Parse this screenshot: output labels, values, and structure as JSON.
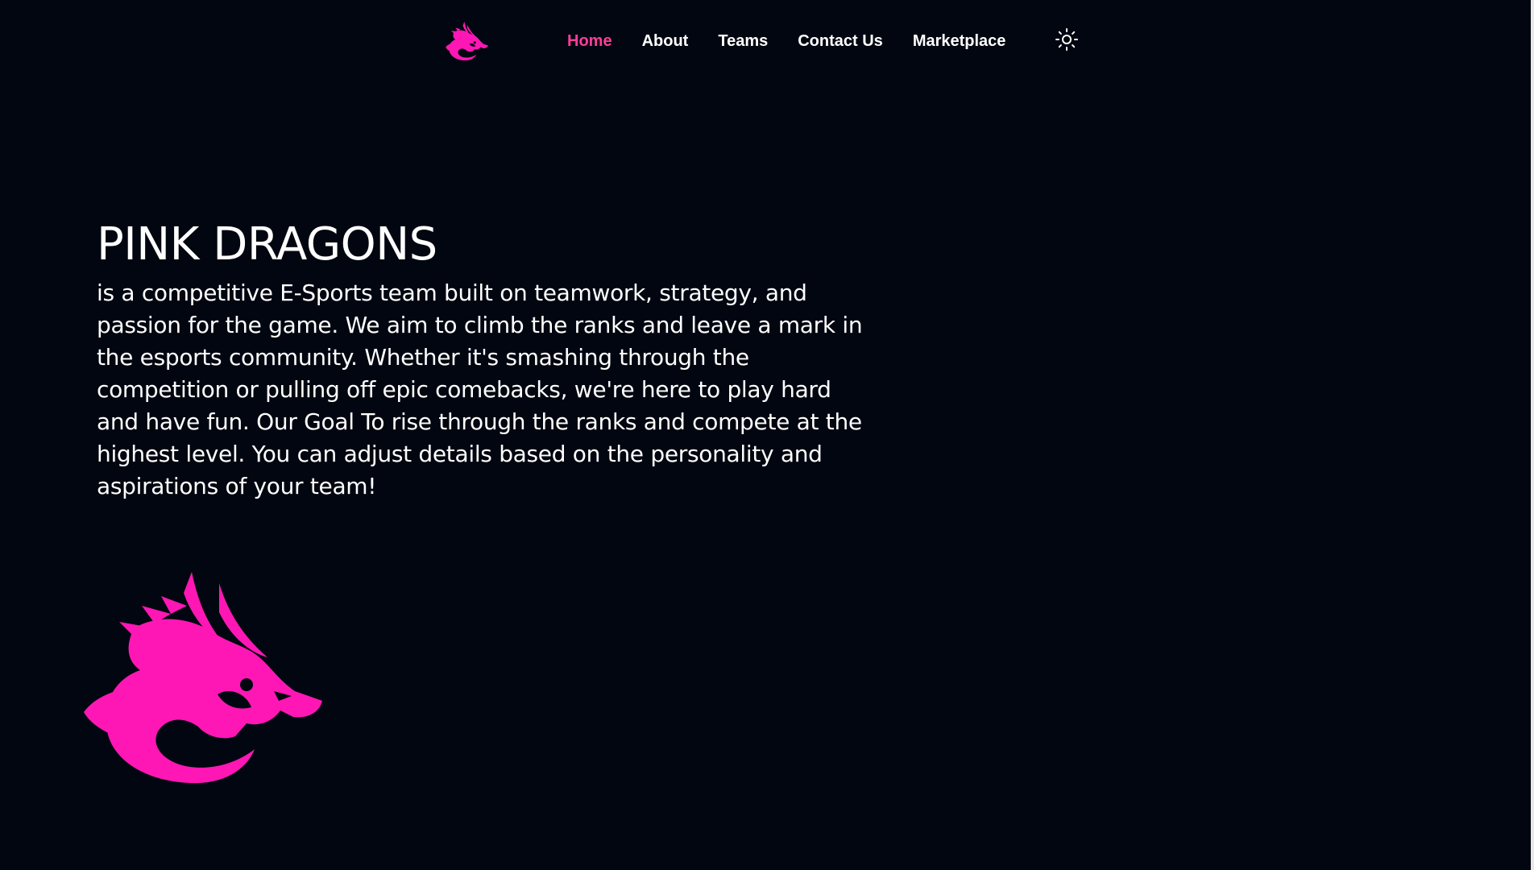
{
  "nav": {
    "links": [
      {
        "label": "Home",
        "active": true
      },
      {
        "label": "About",
        "active": false
      },
      {
        "label": "Teams",
        "active": false
      },
      {
        "label": "Contact Us",
        "active": false
      },
      {
        "label": "Marketplace",
        "active": false
      }
    ],
    "logo_icon": "dragon-logo-icon",
    "theme_icon": "sun-icon"
  },
  "hero": {
    "title": "PINK DRAGONS",
    "description": "is a competitive E-Sports team built on teamwork, strategy, and passion for the game. We aim to climb the ranks and leave a mark in the esports community. Whether it's smashing through the competition or pulling off epic comebacks, we're here to play hard and have fun. Our Goal To rise through the ranks and compete at the highest level. You can adjust details based on the personality and aspirations of your team!"
  },
  "colors": {
    "background": "#020610",
    "accent": "#ff3d9a",
    "brand_pink": "#ff17b5",
    "text": "#ffffff"
  }
}
